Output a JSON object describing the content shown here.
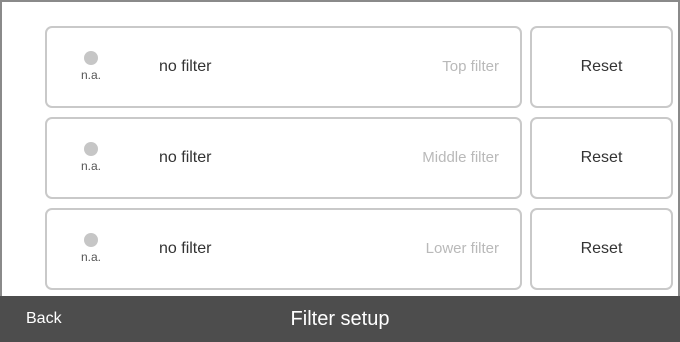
{
  "filters": [
    {
      "status_label": "n.a.",
      "value": "no filter",
      "name": "Top filter",
      "reset_label": "Reset"
    },
    {
      "status_label": "n.a.",
      "value": "no filter",
      "name": "Middle filter",
      "reset_label": "Reset"
    },
    {
      "status_label": "n.a.",
      "value": "no filter",
      "name": "Lower filter",
      "reset_label": "Reset"
    }
  ],
  "footer": {
    "back_label": "Back",
    "title": "Filter setup"
  },
  "colors": {
    "footer_background": "#4d4d4d",
    "card_border": "#c9c9c9",
    "status_dot": "#c6c6c6",
    "muted_text": "#b9b9b9"
  }
}
